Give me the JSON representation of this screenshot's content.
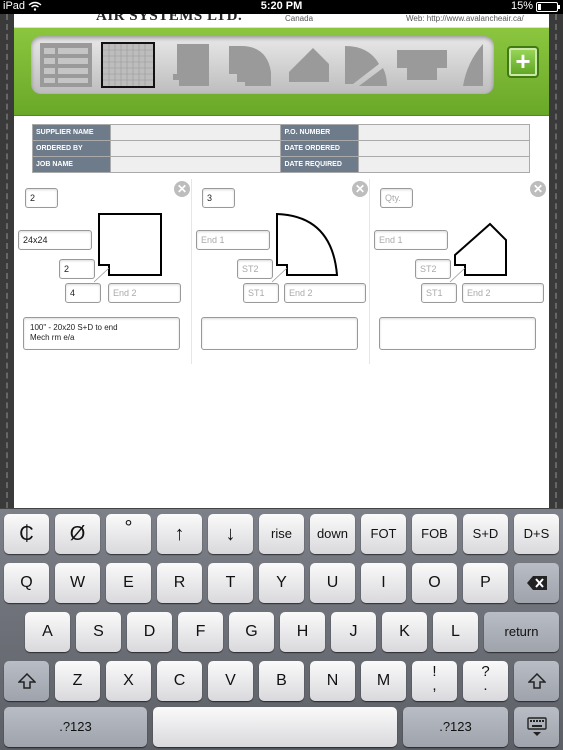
{
  "status": {
    "carrier": "iPad",
    "time": "5:20 PM",
    "battery": "15%",
    "battery_level": 0.15
  },
  "header": {
    "brand": "AIR SYSTEMS LTD.",
    "country": "Canada",
    "web": "Web: http://www.avalancheair.ca/"
  },
  "toolbar": {
    "tools": [
      {
        "name": "list-layout-icon"
      },
      {
        "name": "grid-layout-icon",
        "selected": true
      },
      {
        "name": "offset-duct-icon"
      },
      {
        "name": "elbow-duct-icon"
      },
      {
        "name": "transition-duct-icon"
      },
      {
        "name": "split-elbow-duct-icon"
      },
      {
        "name": "reducer-duct-icon"
      },
      {
        "name": "curved-duct-icon"
      }
    ],
    "add_label": "+"
  },
  "form": {
    "supplier_label": "SUPPLIER NAME",
    "po_label": "P.O. NUMBER",
    "ordered_by_label": "ORDERED BY",
    "date_ordered_label": "DATE ORDERED",
    "job_name_label": "JOB NAME",
    "date_required_label": "DATE REQUIRED",
    "supplier": "",
    "po": "",
    "ordered_by": "",
    "date_ordered": "",
    "job_name": "",
    "date_required": ""
  },
  "cards": [
    {
      "qty": "2",
      "end1": "24x24",
      "st2": "2",
      "st1": "4",
      "end2_placeholder": "End 2",
      "notes_line1": "100\" - 20x20 S+D to end",
      "notes_line2": "Mech rm e/a"
    },
    {
      "qty": "3",
      "end1_placeholder": "End 1",
      "st2_placeholder": "ST2",
      "st1_placeholder": "ST1",
      "end2_placeholder": "End 2"
    },
    {
      "qty_placeholder": "Qty.",
      "end1_placeholder": "End 1",
      "st2_placeholder": "ST2",
      "st1_placeholder": "ST1",
      "end2_placeholder": "End 2"
    }
  ],
  "keyboard": {
    "row0": [
      "₵",
      "Ø",
      "°",
      "↑",
      "↓",
      "rise",
      "down",
      "FOT",
      "FOB",
      "S+D",
      "D+S"
    ],
    "row1": [
      "Q",
      "W",
      "E",
      "R",
      "T",
      "Y",
      "U",
      "I",
      "O",
      "P"
    ],
    "row2": [
      "A",
      "S",
      "D",
      "F",
      "G",
      "H",
      "J",
      "K",
      "L"
    ],
    "row3": [
      "Z",
      "X",
      "C",
      "V",
      "B",
      "N",
      "M"
    ],
    "return": "return",
    "numbers": ".?123",
    "backspace_icon": "backspace-icon",
    "shift_icon": "shift-icon",
    "hide_icon": "keyboard-hide-icon",
    "excl_top": "!",
    "excl_bottom": ",",
    "quest_top": "?",
    "quest_bottom": "."
  }
}
